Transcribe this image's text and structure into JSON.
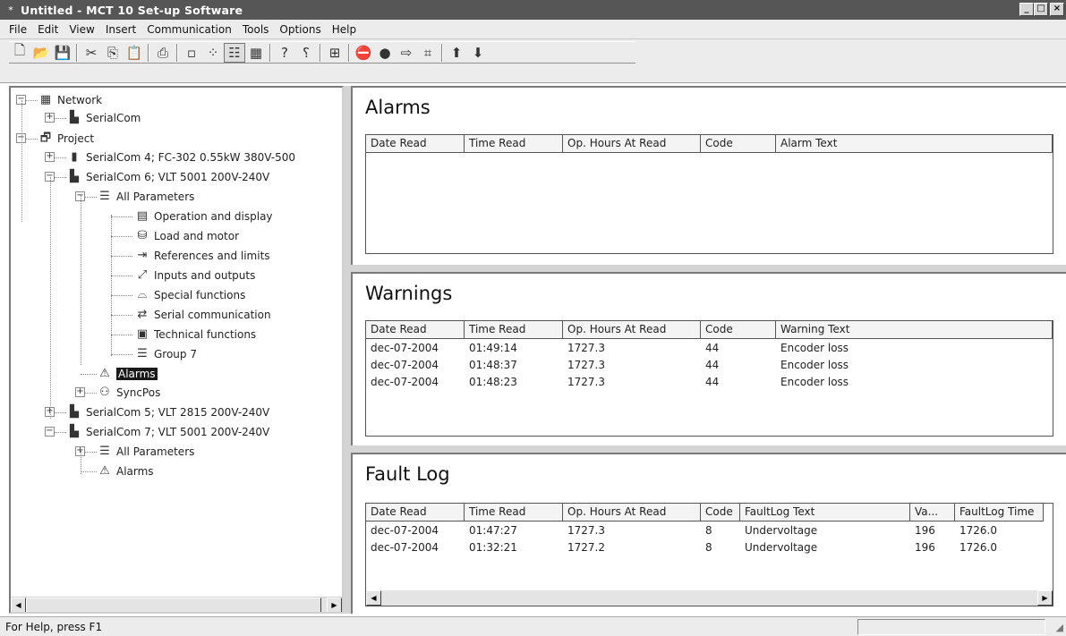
{
  "window": {
    "title": "Untitled - MCT 10 Set-up Software",
    "app_icon": "mct-app-icon",
    "modified_marker": "*",
    "min": "_",
    "max": "□",
    "close": "×"
  },
  "menu": [
    "File",
    "Edit",
    "View",
    "Insert",
    "Communication",
    "Tools",
    "Options",
    "Help"
  ],
  "toolbar": {
    "buttons": [
      {
        "icon": "new-document-icon",
        "glyph": "🗋"
      },
      {
        "icon": "open-folder-icon",
        "glyph": "📂"
      },
      {
        "icon": "save-icon",
        "glyph": "💾"
      },
      {
        "sep": true
      },
      {
        "icon": "cut-icon",
        "glyph": "✂"
      },
      {
        "icon": "copy-icon",
        "glyph": "⎘"
      },
      {
        "icon": "paste-icon",
        "glyph": "📋"
      },
      {
        "sep": true
      },
      {
        "icon": "print-icon",
        "glyph": "⎙"
      },
      {
        "sep": true
      },
      {
        "icon": "large-icons-icon",
        "glyph": "▫"
      },
      {
        "icon": "small-icons-icon",
        "glyph": "⁘"
      },
      {
        "icon": "list-view-icon",
        "glyph": "☷",
        "pressed": true
      },
      {
        "icon": "details-view-icon",
        "glyph": "▦"
      },
      {
        "sep": true
      },
      {
        "icon": "help-icon",
        "glyph": "?"
      },
      {
        "icon": "context-help-icon",
        "glyph": "⸮"
      },
      {
        "sep": true
      },
      {
        "icon": "drive-icon",
        "glyph": "⊞"
      },
      {
        "sep": true
      },
      {
        "icon": "stop-icon",
        "glyph": "⛔"
      },
      {
        "icon": "record-icon",
        "glyph": "●"
      },
      {
        "icon": "write-to-drive-icon",
        "glyph": "⇨"
      },
      {
        "icon": "scan-icon",
        "glyph": "⌗"
      },
      {
        "sep": true
      },
      {
        "icon": "arrow-up-icon",
        "glyph": "⬆"
      },
      {
        "icon": "arrow-down-icon",
        "glyph": "⬇"
      }
    ]
  },
  "tree": [
    {
      "label": "Network",
      "icon": "network-grid-icon",
      "glyph": "▦",
      "expander": "−"
    },
    {
      "label": "SerialCom",
      "icon": "serial-port-icon",
      "glyph": "▙",
      "expander": "+"
    },
    {
      "label": "Project",
      "icon": "project-icon",
      "glyph": "🗗",
      "expander": "−"
    },
    {
      "label": "SerialCom 4; FC-302 0.55kW 380V-500",
      "icon": "drive-device-icon",
      "glyph": "▮",
      "expander": "+"
    },
    {
      "label": "SerialCom 6; VLT 5001 200V-240V",
      "icon": "vlt5001-icon",
      "glyph": "▙",
      "expander": "−"
    },
    {
      "label": "All Parameters",
      "icon": "list-icon",
      "glyph": "☰",
      "expander": "−"
    },
    {
      "label": "Operation and display",
      "icon": "display-icon",
      "glyph": "▤"
    },
    {
      "label": "Load and motor",
      "icon": "motor-icon",
      "glyph": "⛁"
    },
    {
      "label": "References and limits",
      "icon": "limits-icon",
      "glyph": "⇥"
    },
    {
      "label": "Inputs and outputs",
      "icon": "io-icon",
      "glyph": "⤢"
    },
    {
      "label": "Special functions",
      "icon": "special-functions-icon",
      "glyph": "⌓"
    },
    {
      "label": "Serial communication",
      "icon": "serial-comm-icon",
      "glyph": "⇄"
    },
    {
      "label": "Technical functions",
      "icon": "technical-icon",
      "glyph": "▣"
    },
    {
      "label": "Group 7",
      "icon": "list-icon",
      "glyph": "☰"
    },
    {
      "label": "Alarms",
      "icon": "warning-triangle-icon",
      "glyph": "⚠",
      "selected": true
    },
    {
      "label": "SyncPos",
      "icon": "syncpos-icon",
      "glyph": "⚇",
      "expander": "+"
    },
    {
      "label": "SerialCom 5; VLT 2815 200V-240V",
      "icon": "vlt2815-icon",
      "glyph": "▙",
      "expander": "+"
    },
    {
      "label": "SerialCom 7; VLT 5001 200V-240V",
      "icon": "vlt5001-icon",
      "glyph": "▙",
      "expander": "−"
    },
    {
      "label": "All Parameters",
      "icon": "list-icon",
      "glyph": "☰",
      "expander": "+"
    },
    {
      "label": "Alarms",
      "icon": "warning-triangle-icon",
      "glyph": "⚠"
    }
  ],
  "scroll": {
    "left": "◀",
    "right": "▶"
  },
  "alarms": {
    "title": "Alarms",
    "columns": [
      "Date Read",
      "Time Read",
      "Op. Hours At Read",
      "Code",
      "Alarm Text"
    ],
    "rows": []
  },
  "warnings": {
    "title": "Warnings",
    "columns": [
      "Date Read",
      "Time Read",
      "Op. Hours At Read",
      "Code",
      "Warning Text"
    ],
    "rows": [
      [
        "dec-07-2004",
        "01:49:14",
        "1727.3",
        "44",
        "Encoder loss"
      ],
      [
        "dec-07-2004",
        "01:48:37",
        "1727.3",
        "44",
        "Encoder loss"
      ],
      [
        "dec-07-2004",
        "01:48:23",
        "1727.3",
        "44",
        "Encoder loss"
      ]
    ]
  },
  "faultlog": {
    "title": "Fault Log",
    "columns": [
      "Date Read",
      "Time Read",
      "Op. Hours At Read",
      "Code",
      "FaultLog Text",
      "Va...",
      "FaultLog Time"
    ],
    "rows": [
      [
        "dec-07-2004",
        "01:47:27",
        "1727.3",
        "8",
        "Undervoltage",
        "196",
        "1726.0"
      ],
      [
        "dec-07-2004",
        "01:32:21",
        "1727.2",
        "8",
        "Undervoltage",
        "196",
        "1726.0"
      ]
    ]
  },
  "status": {
    "text": "For Help, press F1",
    "grip": "◢"
  }
}
